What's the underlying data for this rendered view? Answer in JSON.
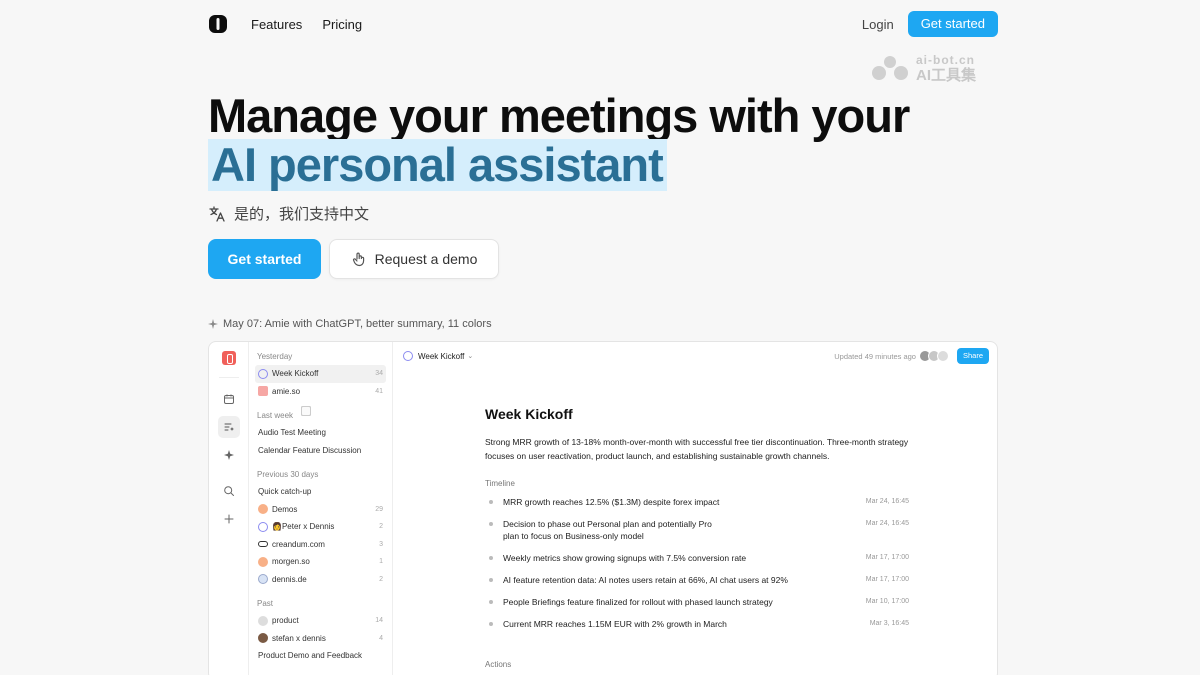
{
  "nav": {
    "links": [
      "Features",
      "Pricing"
    ],
    "login": "Login",
    "cta": "Get started"
  },
  "watermark": {
    "line1": "ai-bot.cn",
    "line2": "AI工具集"
  },
  "hero": {
    "line1": "Manage your meetings with your",
    "line2": "AI personal assistant",
    "lang_note": "是的，我们支持中文",
    "cta_primary": "Get started",
    "cta_secondary": "Request a demo"
  },
  "announcement": "May 07: Amie with ChatGPT, better summary, 11 colors",
  "app": {
    "sidebar": {
      "sections": [
        {
          "label": "Yesterday",
          "items": [
            {
              "label": "Week Kickoff",
              "count": "34",
              "icon": "sync-icon"
            },
            {
              "label": "amie.so",
              "count": "41",
              "icon": "amie-icon"
            }
          ]
        },
        {
          "label": "Last week",
          "items": [
            {
              "label": "Audio Test Meeting",
              "count": "",
              "icon": "doc-icon"
            },
            {
              "label": "Calendar Feature Discussion",
              "count": "",
              "icon": "doc-icon"
            }
          ]
        },
        {
          "label": "Previous 30 days",
          "items": [
            {
              "label": "Quick catch-up",
              "count": "",
              "icon": "doc-icon"
            },
            {
              "label": "Demos",
              "count": "29",
              "icon": "demos-icon"
            },
            {
              "label": "👩Peter x Dennis",
              "count": "2",
              "icon": "sync-icon"
            },
            {
              "label": "creandum.com",
              "count": "3",
              "icon": "link-icon"
            },
            {
              "label": "morgen.so",
              "count": "1",
              "icon": "org-icon"
            },
            {
              "label": "dennis.de",
              "count": "2",
              "icon": "globe-icon"
            }
          ]
        },
        {
          "label": "Past",
          "items": [
            {
              "label": "product",
              "count": "14",
              "icon": "org-icon"
            },
            {
              "label": "stefan x dennis",
              "count": "4",
              "icon": "avatar-icon"
            },
            {
              "label": "Product Demo and Feedback",
              "count": "",
              "icon": "doc-icon"
            }
          ]
        }
      ]
    },
    "topbar": {
      "title": "Week Kickoff",
      "updated": "Updated 49 minutes ago",
      "share": "Share"
    },
    "document": {
      "title": "Week Kickoff",
      "summary": "Strong MRR growth of 13-18% month-over-month with successful free tier discontinuation. Three-month strategy focuses on user reactivation, product launch, and establishing sustainable growth channels.",
      "timeline_label": "Timeline",
      "timeline": [
        {
          "text": "MRR growth reaches 12.5% ($1.3M) despite forex impact",
          "date": "Mar 24, 16:45"
        },
        {
          "text": "Decision to phase out Personal plan and potentially Pro plan to focus on Business-only model",
          "date": "Mar 24, 16:45"
        },
        {
          "text": "Weekly metrics show growing signups with 7.5% conversion rate",
          "date": "Mar 17, 17:00"
        },
        {
          "text": "AI feature retention data: AI notes users retain at 66%, AI chat users at 92%",
          "date": "Mar 17, 17:00"
        },
        {
          "text": "People Briefings feature finalized for rollout with phased launch strategy",
          "date": "Mar 10, 17:00"
        },
        {
          "text": "Current MRR reaches 1.15M EUR with 2% growth in March",
          "date": "Mar 3, 16:45"
        }
      ],
      "actions_label": "Actions"
    }
  }
}
